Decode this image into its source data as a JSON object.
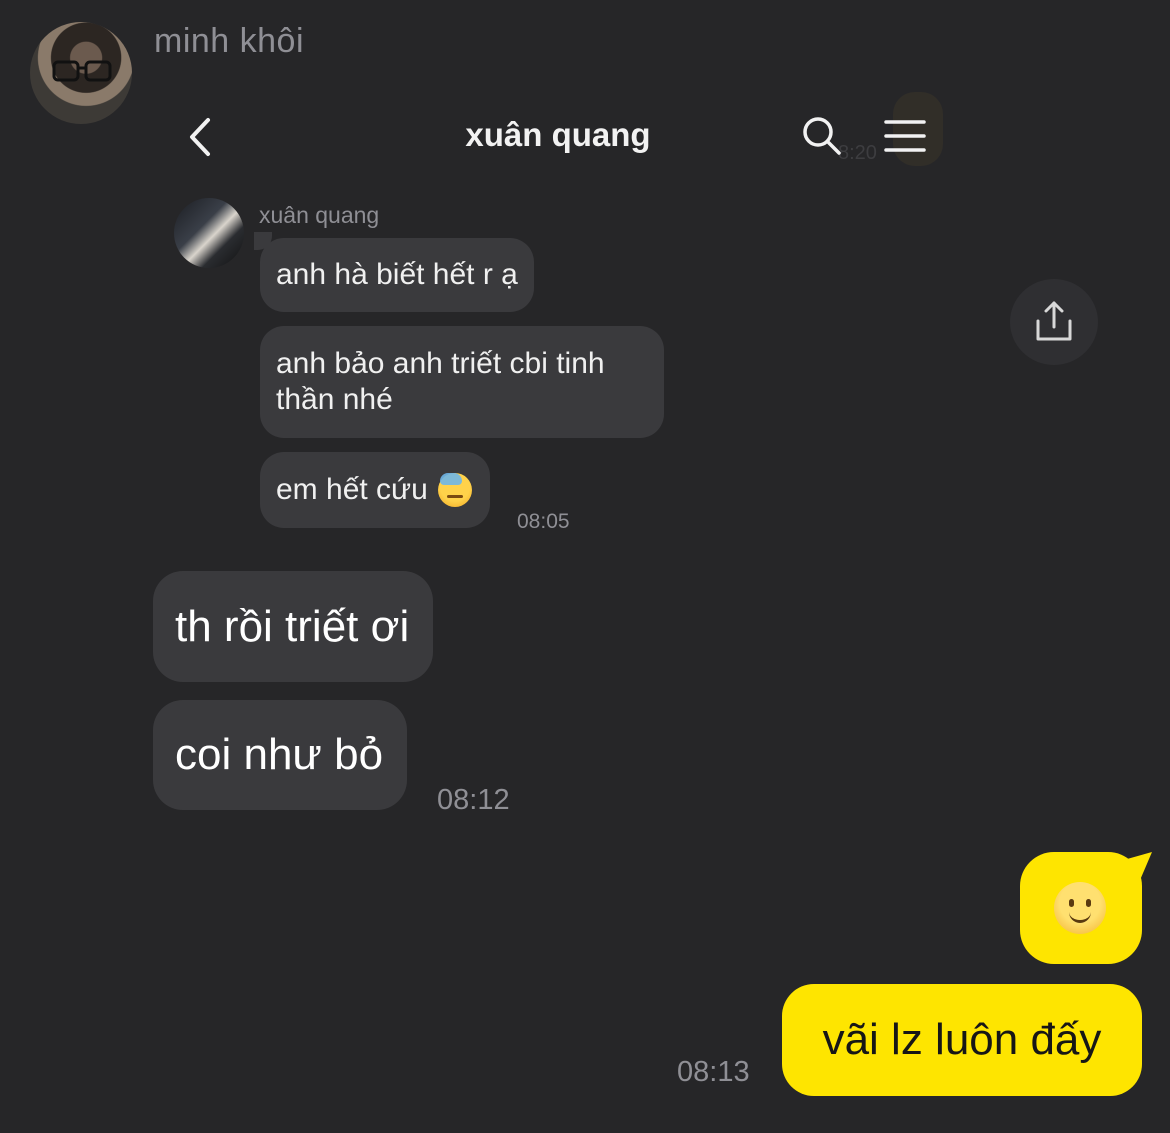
{
  "outer": {
    "name": "minh khôi"
  },
  "header": {
    "title": "xuân quang",
    "ghost_time": "8:20"
  },
  "thread": {
    "sender_name": "xuân quang",
    "incoming_small": [
      {
        "text": "anh hà biết hết r ạ"
      },
      {
        "text": "anh bảo anh triết cbi tinh thần nhé"
      },
      {
        "text": "em hết cứu",
        "emoji": "sweat-face"
      }
    ],
    "incoming_small_time": "08:05",
    "incoming_big": [
      {
        "text": "th rồi triết ơi"
      },
      {
        "text": "coi như bỏ"
      }
    ],
    "incoming_big_time": "08:12",
    "outgoing": [
      {
        "emoji": "slightly-smiling-face"
      },
      {
        "text": "vãi lz luôn đấy"
      }
    ],
    "outgoing_time": "08:13"
  },
  "colors": {
    "background": "#262628",
    "incoming_bubble": "#3a3a3d",
    "outgoing_bubble": "#fee500",
    "muted_text": "#8f8f95"
  }
}
